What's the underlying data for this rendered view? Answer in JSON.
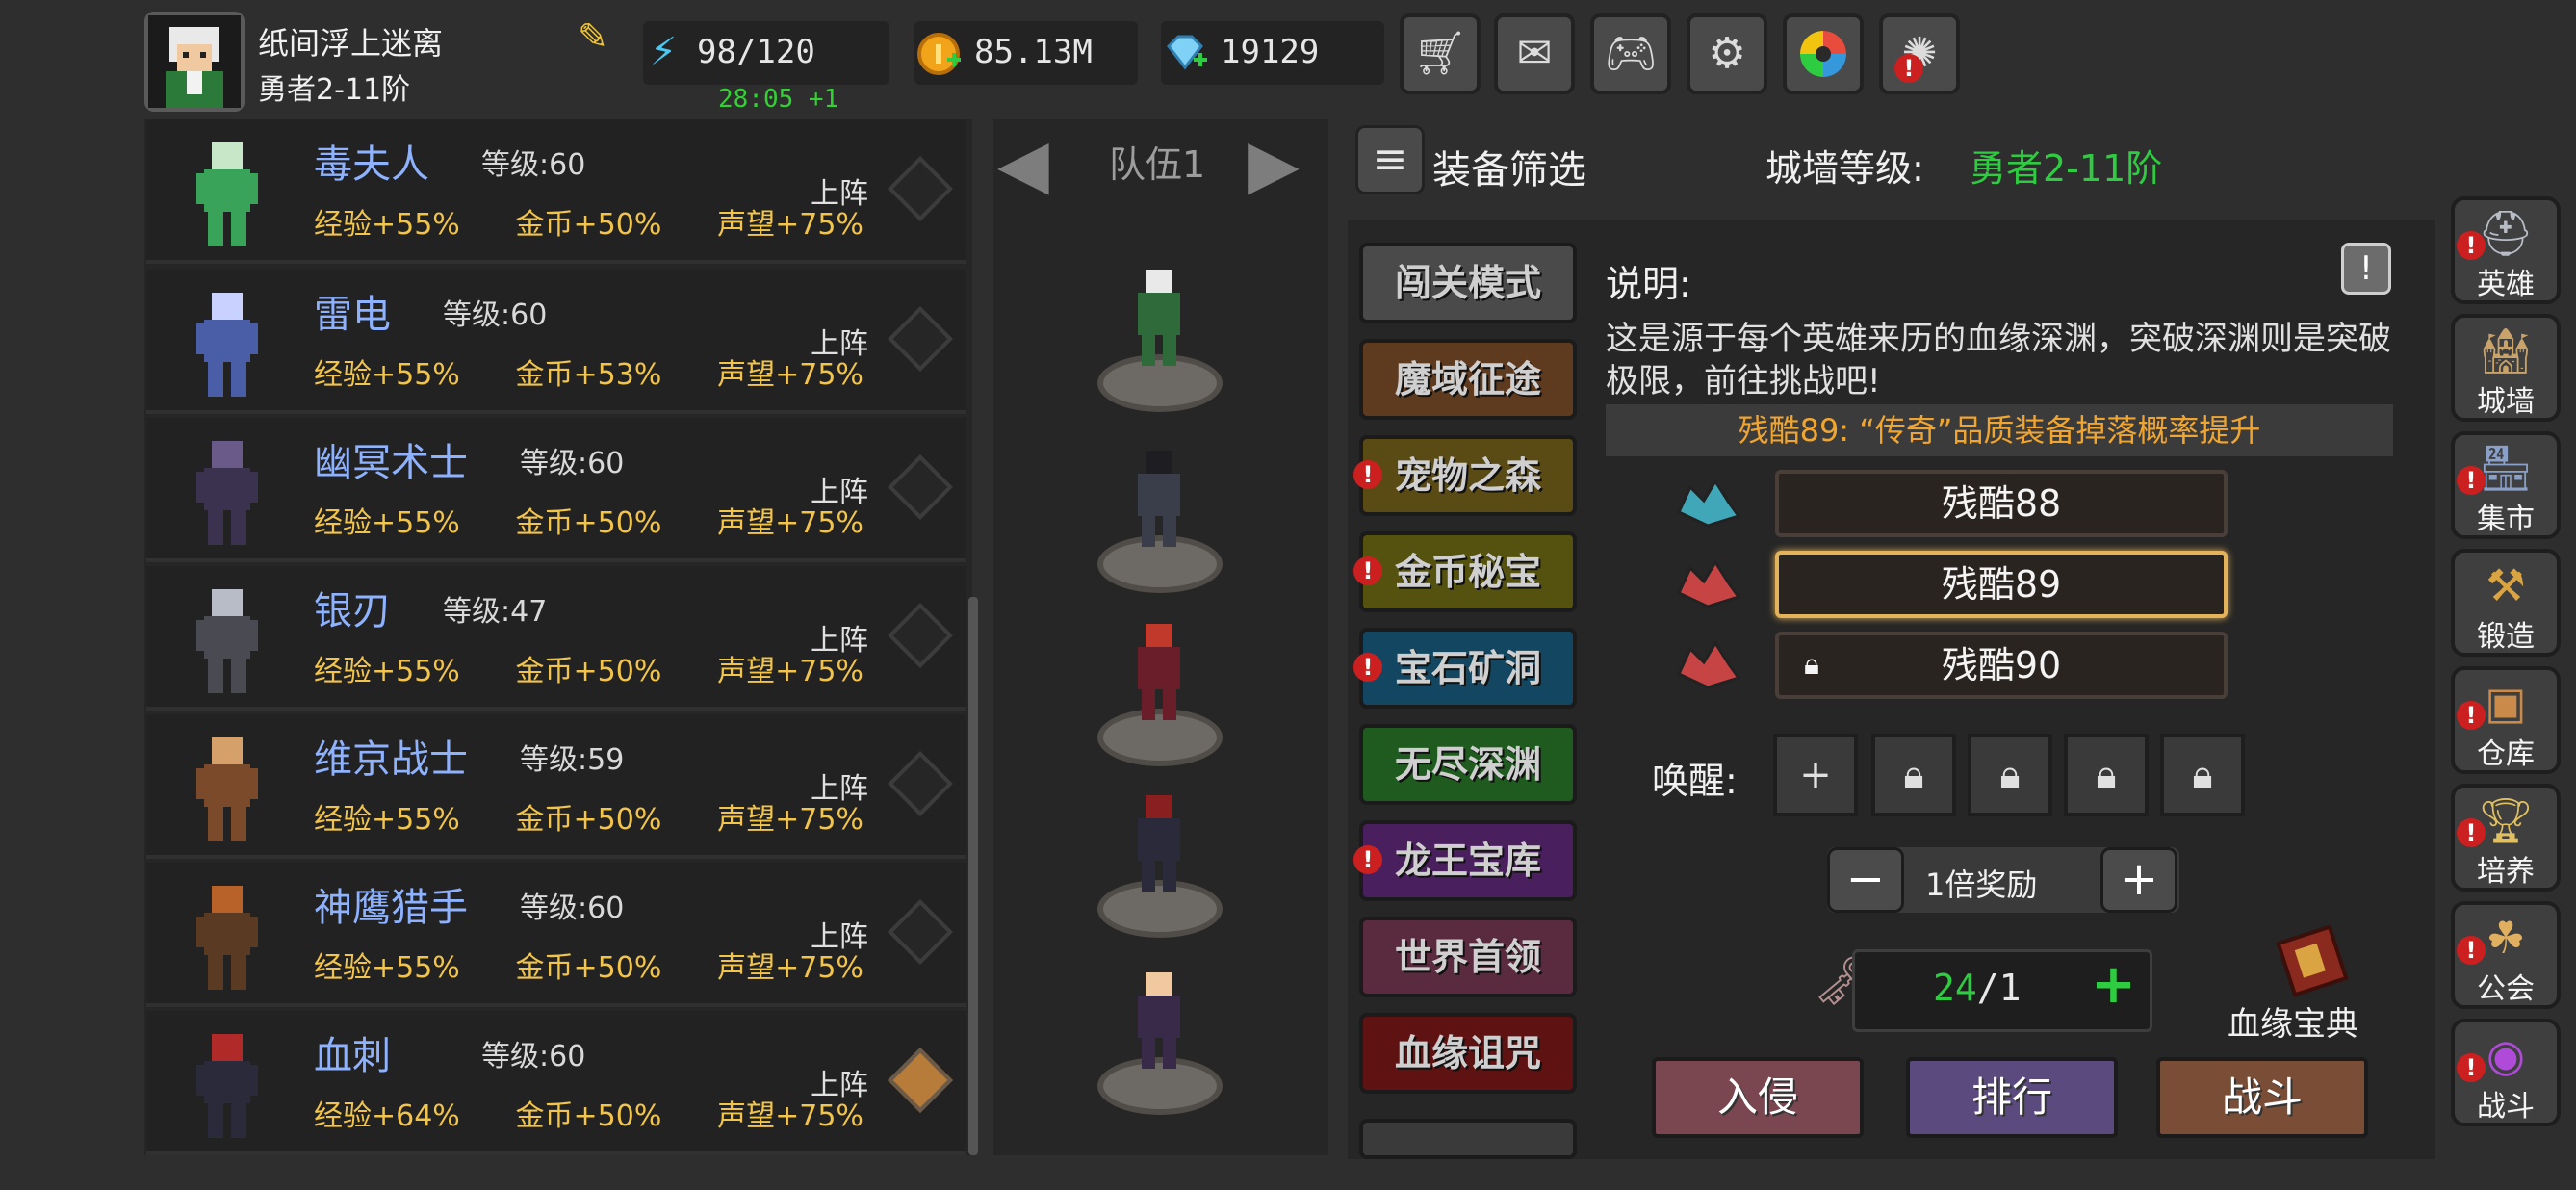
{
  "player": {
    "name": "纸间浮上迷离",
    "rank": "勇者2-11阶"
  },
  "resources": {
    "energy": "98/120",
    "energy_timer": "28:05 +1",
    "gold": "85.13M",
    "gems": "19129"
  },
  "top_buttons": [
    "shop",
    "mail",
    "gamepad",
    "settings",
    "aperture",
    "fireworks"
  ],
  "heroes": [
    {
      "name": "毒夫人",
      "level": "等级:60",
      "exp": "经验+55%",
      "gold": "金币+50%",
      "fame": "声望+75%",
      "deploy": "上阵",
      "selected": false
    },
    {
      "name": "雷电",
      "level": "等级:60",
      "exp": "经验+55%",
      "gold": "金币+53%",
      "fame": "声望+75%",
      "deploy": "上阵",
      "selected": false
    },
    {
      "name": "幽冥术士",
      "level": "等级:60",
      "exp": "经验+55%",
      "gold": "金币+50%",
      "fame": "声望+75%",
      "deploy": "上阵",
      "selected": false
    },
    {
      "name": "银刃",
      "level": "等级:47",
      "exp": "经验+55%",
      "gold": "金币+50%",
      "fame": "声望+75%",
      "deploy": "上阵",
      "selected": false
    },
    {
      "name": "维京战士",
      "level": "等级:59",
      "exp": "经验+55%",
      "gold": "金币+50%",
      "fame": "声望+75%",
      "deploy": "上阵",
      "selected": false
    },
    {
      "name": "神鹰猎手",
      "level": "等级:60",
      "exp": "经验+55%",
      "gold": "金币+50%",
      "fame": "声望+75%",
      "deploy": "上阵",
      "selected": false
    },
    {
      "name": "血刺",
      "level": "等级:60",
      "exp": "经验+64%",
      "gold": "金币+50%",
      "fame": "声望+75%",
      "deploy": "上阵",
      "selected": true
    }
  ],
  "team": {
    "title": "队伍1"
  },
  "filter_label": "装备筛选",
  "wall": {
    "label": "城墙等级:",
    "value": "勇者2-11阶"
  },
  "modes": [
    {
      "label": "闯关模式",
      "color": "#4a4a4a",
      "alert": false
    },
    {
      "label": "魔域征途",
      "color": "#5e3a1e",
      "alert": false
    },
    {
      "label": "宠物之森",
      "color": "#5a4a14",
      "alert": true
    },
    {
      "label": "金币秘宝",
      "color": "#55520f",
      "alert": true
    },
    {
      "label": "宝石矿洞",
      "color": "#134660",
      "alert": true
    },
    {
      "label": "无尽深渊",
      "color": "#1f5a1f",
      "alert": false
    },
    {
      "label": "龙王宝库",
      "color": "#4a1f5e",
      "alert": true
    },
    {
      "label": "世界首领",
      "color": "#5a2a3e",
      "alert": false
    },
    {
      "label": "血缘诅咒",
      "color": "#5e1212",
      "alert": false
    }
  ],
  "description": {
    "title": "说明:",
    "text": "这是源于每个英雄来历的血缘深渊，突破深渊则是突破极限，前往挑战吧!",
    "bonus": "残酷89: “传奇”品质装备掉落概率提升"
  },
  "difficulties": [
    {
      "label": "残酷88",
      "selected": false,
      "locked": false
    },
    {
      "label": "残酷89",
      "selected": true,
      "locked": false
    },
    {
      "label": "残酷90",
      "selected": false,
      "locked": true
    }
  ],
  "awaken": {
    "label": "唤醒:"
  },
  "multiplier": {
    "label": "1倍奖励"
  },
  "keys": {
    "current": "24",
    "max": "/1"
  },
  "codex_label": "血缘宝典",
  "actions": [
    {
      "label": "入侵",
      "color": "#7a4650"
    },
    {
      "label": "排行",
      "color": "#5a4a7e"
    },
    {
      "label": "战斗",
      "color": "#7a4e36"
    }
  ],
  "nav": [
    {
      "label": "英雄",
      "icon": "helmet-icon",
      "alert": true
    },
    {
      "label": "城墙",
      "icon": "castle-icon",
      "alert": false
    },
    {
      "label": "集市",
      "icon": "market-icon",
      "alert": true
    },
    {
      "label": "锻造",
      "icon": "anvil-icon",
      "alert": false
    },
    {
      "label": "仓库",
      "icon": "chest-icon",
      "alert": true
    },
    {
      "label": "培养",
      "icon": "trophy-icon",
      "alert": true
    },
    {
      "label": "公会",
      "icon": "guild-icon",
      "alert": true
    },
    {
      "label": "战斗",
      "icon": "portal-icon",
      "alert": true
    }
  ]
}
